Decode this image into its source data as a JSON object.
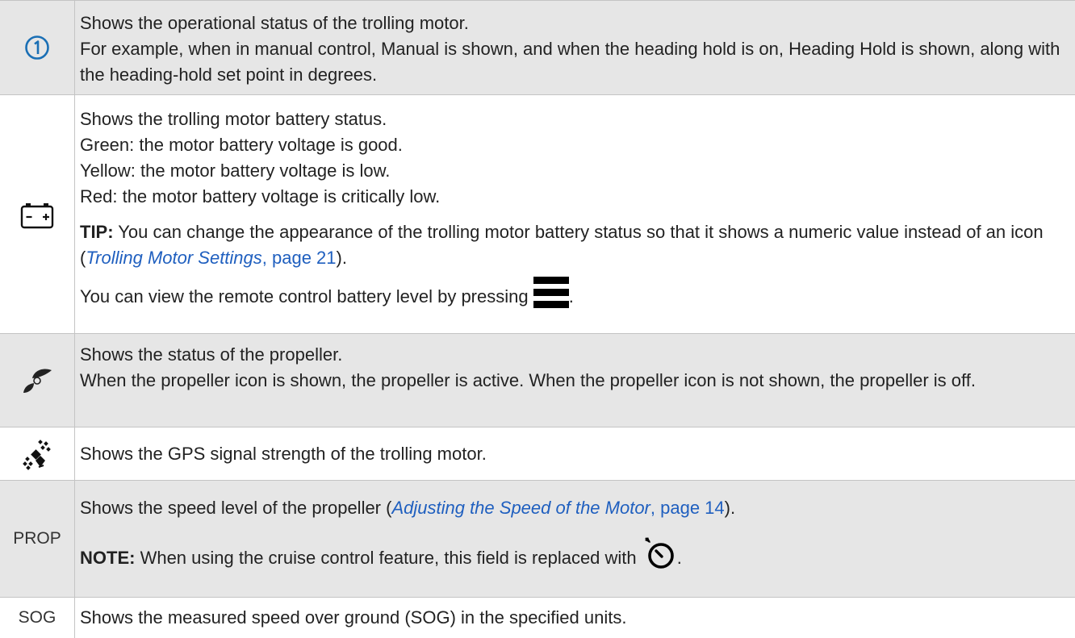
{
  "rows": [
    {
      "icon": "circled-1-icon",
      "lines": [
        "Shows the operational status of the trolling motor.",
        "For example, when in manual control, Manual is shown, and when the heading hold is on, Heading Hold is shown, along with the heading-hold set point in degrees."
      ]
    },
    {
      "icon": "battery-icon",
      "lines": [
        "Shows the trolling motor battery status.",
        "Green: the motor battery voltage is good.",
        "Yellow: the motor battery voltage is low.",
        "Red: the motor battery voltage is critically low."
      ],
      "tip_label": "TIP:",
      "tip_text": " You can change the appearance of the trolling motor battery status so that it shows a numeric value instead of an icon (",
      "tip_link": "Trolling Motor Settings",
      "tip_page": ", page 21",
      "tip_end": ").",
      "remote_text": "You can view the remote control battery level by pressing ",
      "remote_icon": "menu-icon",
      "remote_end": "."
    },
    {
      "icon": "propeller-icon",
      "lines": [
        "Shows the status of the propeller.",
        "When the propeller icon is shown, the propeller is active. When the propeller icon is not shown, the propeller is off."
      ]
    },
    {
      "icon": "gps-satellite-icon",
      "lines": [
        "Shows the GPS signal strength of the trolling motor."
      ]
    },
    {
      "label": "PROP",
      "speed_text": "Shows the speed level of the propeller (",
      "speed_link": "Adjusting the Speed of the Motor",
      "speed_page": ", page 14",
      "speed_end": ").",
      "note_label": "NOTE:",
      "note_text": " When using the cruise control feature, this field is replaced with ",
      "note_icon": "cruise-control-icon",
      "note_end": "."
    },
    {
      "label": "SOG",
      "lines": [
        "Shows the measured speed over ground (SOG) in the specified units."
      ]
    }
  ],
  "colors": {
    "accent": "#1f5fbf",
    "shade": "#e6e6e6",
    "text": "#222222"
  }
}
